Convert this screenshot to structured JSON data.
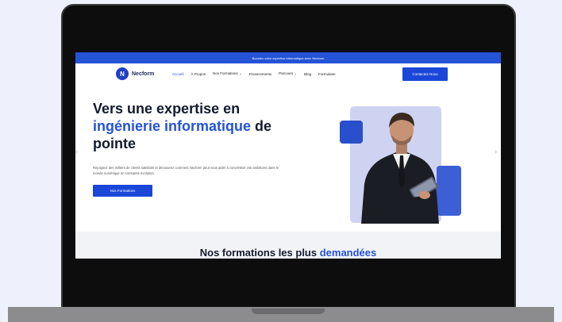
{
  "topbar": {
    "text": "Boostez votre expertise informatique avec Necform"
  },
  "brand": {
    "initial": "N",
    "name": "Necform"
  },
  "nav": {
    "items": [
      {
        "label": "Accueil"
      },
      {
        "label": "À Propos"
      },
      {
        "label": "Nos Formations ⌄"
      },
      {
        "label": "Financements"
      },
      {
        "label": "Parcours ⌄"
      },
      {
        "label": "Blog"
      },
      {
        "label": "Formulaire"
      }
    ],
    "cta": "Contactez-Nous"
  },
  "hero": {
    "title_line1": "Vers une expertise en",
    "title_highlight": "ingénierie informatique",
    "title_line2_rest": " de",
    "title_line3": "pointe",
    "description": "Rejoignez des milliers de clients satisfaits et découvrez comment Necform peut vous aider à concrétiser vos ambitions dans le monde numérique en constante évolution.",
    "button": "Nos Formations"
  },
  "section": {
    "title_prefix": "Nos formations les plus ",
    "title_highlight": "demandées"
  },
  "carousel": {
    "prev": "‹",
    "next": "›"
  },
  "colors": {
    "primary": "#2453d6",
    "dark": "#141b2e",
    "card": "#cfd3f2"
  }
}
